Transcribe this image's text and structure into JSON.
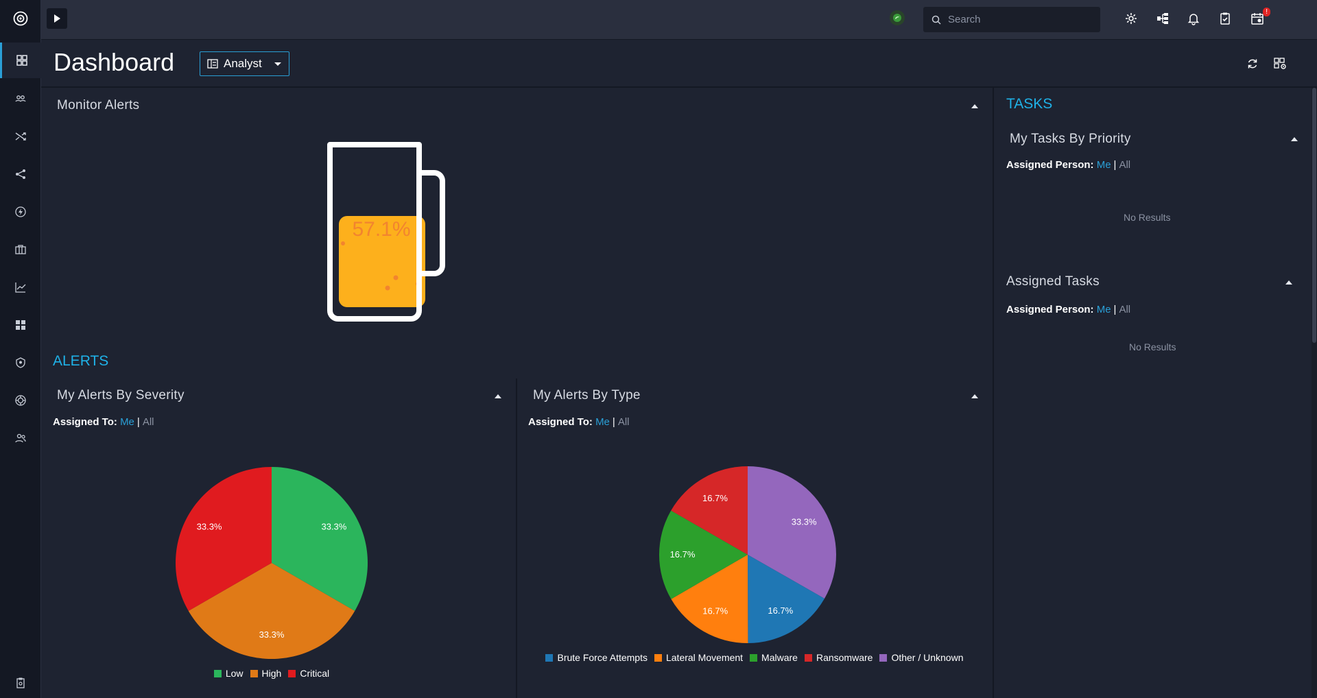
{
  "app": {
    "search": {
      "placeholder": "Search"
    },
    "notification_badge": "!"
  },
  "sidebar": {
    "items": [
      {
        "name": "sidebar-item-dashboard",
        "icon": "dashboard-icon",
        "active": true
      },
      {
        "name": "sidebar-item-users",
        "icon": "users-icon",
        "active": false
      },
      {
        "name": "sidebar-item-workflows",
        "icon": "shuffle-icon",
        "active": false
      },
      {
        "name": "sidebar-item-graph",
        "icon": "graph-icon",
        "active": false
      },
      {
        "name": "sidebar-item-automation",
        "icon": "bolt-icon",
        "active": false
      },
      {
        "name": "sidebar-item-cases",
        "icon": "briefcase-icon",
        "active": false
      },
      {
        "name": "sidebar-item-reports",
        "icon": "line-chart-icon",
        "active": false
      },
      {
        "name": "sidebar-item-widgets",
        "icon": "grid-icon",
        "active": false
      },
      {
        "name": "sidebar-item-security",
        "icon": "shield-icon",
        "active": false
      },
      {
        "name": "sidebar-item-threat-intel",
        "icon": "target-icon",
        "active": false
      },
      {
        "name": "sidebar-item-teams",
        "icon": "team-icon",
        "active": false
      }
    ]
  },
  "header": {
    "title": "Dashboard",
    "view_selector": "Analyst"
  },
  "monitor": {
    "title": "Monitor Alerts",
    "gauge_label": "57.1%",
    "gauge_level": 0.571
  },
  "alerts": {
    "section_title": "ALERTS",
    "severity": {
      "title": "My Alerts By Severity",
      "filter_label": "Assigned To:",
      "me": "Me",
      "sep": "|",
      "all": "All"
    },
    "type": {
      "title": "My Alerts By Type",
      "filter_label": "Assigned To:",
      "me": "Me",
      "sep": "|",
      "all": "All"
    }
  },
  "tasks": {
    "section_title": "TASKS",
    "by_priority": {
      "title": "My Tasks By Priority",
      "filter_label": "Assigned Person:",
      "me": "Me",
      "sep": "|",
      "all": "All",
      "empty": "No Results"
    },
    "assigned": {
      "title": "Assigned Tasks",
      "filter_label": "Assigned Person:",
      "me": "Me",
      "sep": "|",
      "all": "All",
      "empty": "No Results"
    }
  },
  "colors": {
    "accent": "#1fb2e8",
    "beer": "#fdb01c"
  },
  "chart_data": [
    {
      "type": "pie",
      "title": "My Alerts By Severity",
      "categories": [
        "Low",
        "High",
        "Critical"
      ],
      "values": [
        33.3,
        33.3,
        33.3
      ],
      "labels": [
        "33.3%",
        "33.3%",
        "33.3%"
      ],
      "colors": [
        "#2bb55c",
        "#e07a17",
        "#e01b1f"
      ],
      "legend": "bottom"
    },
    {
      "type": "pie",
      "title": "My Alerts By Type",
      "categories": [
        "Other / Unknown",
        "Brute Force Attempts",
        "Lateral Movement",
        "Malware",
        "Ransomware"
      ],
      "values": [
        33.3,
        16.7,
        16.7,
        16.7,
        16.7
      ],
      "labels": [
        "33.3%",
        "16.7%",
        "16.7%",
        "16.7%",
        "16.7%"
      ],
      "colors": [
        "#9467bd",
        "#1f77b4",
        "#ff7f0e",
        "#2ca02c",
        "#d62728"
      ],
      "legend_order": [
        "Brute Force Attempts",
        "Lateral Movement",
        "Malware",
        "Ransomware",
        "Other / Unknown"
      ],
      "legend": "bottom"
    }
  ]
}
